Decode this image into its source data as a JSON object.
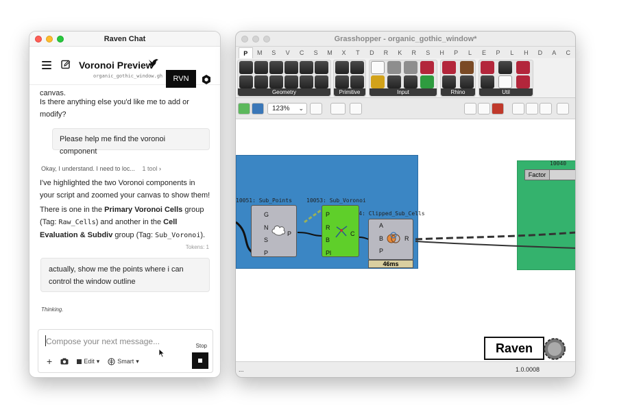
{
  "chat_window": {
    "title": "Raven Chat",
    "header": {
      "preview_title": "Voronoi Preview",
      "file_name": "organic_gothic_window.gh",
      "badge": "RVN"
    },
    "messages": {
      "truncated_text": "canvas.",
      "question": "Is there anything else you'd like me to add or modify?",
      "user_1": "Please help me find the voronoi component",
      "tool_summary": "Okay, I understand. I need to loc...",
      "tool_count": "1 tool",
      "answer_1": "I've highlighted the two Voronoi components in your script and zoomed your canvas to show them!",
      "answer_2_pre": "There is one in the ",
      "answer_2_group1": "Primary Voronoi Cells",
      "answer_2_mid1": " group (Tag: ",
      "answer_2_tag1": "Raw_Cells",
      "answer_2_mid2": ") and another in the ",
      "answer_2_group2": "Cell Evaluation & Subdiv",
      "answer_2_mid3": " group (Tag: ",
      "answer_2_tag2": "Sub_Voronoi",
      "answer_2_end": ").",
      "tokens": "Tokens: 1",
      "user_2": "actually, show me the points where i can control the window outline",
      "thinking": "Thinking."
    },
    "composer": {
      "placeholder": "Compose your next message...",
      "stop_label": "Stop",
      "edit_label": "Edit",
      "mode_label": "Smart"
    }
  },
  "gh_window": {
    "title": "Grasshopper - organic_gothic_window*",
    "tabs": [
      "P",
      "M",
      "S",
      "V",
      "C",
      "S",
      "M",
      "X",
      "T",
      "D",
      "R",
      "K",
      "R",
      "S",
      "H",
      "P",
      "L",
      "E",
      "P",
      "L",
      "H",
      "D",
      "A",
      "C"
    ],
    "ribbon_groups": [
      "Geometry",
      "Primitive",
      "Input",
      "Rhino",
      "Util"
    ],
    "zoom": "123%",
    "canvas": {
      "label_sub_points": "10051: Sub_Points",
      "label_sub_voronoi": "10053: Sub_Voronoi",
      "label_clipped": "10054: Clipped_Sub_Cells",
      "label_green_group": "10040",
      "factor_label": "Factor",
      "timing": "46ms",
      "comp1_ports": [
        "G",
        "N",
        "S",
        "P"
      ],
      "comp1_out": "P",
      "comp2_ports": [
        "P",
        "R",
        "B",
        "Pl"
      ],
      "comp2_out": "C",
      "comp3_ports": [
        "A",
        "B",
        "P"
      ],
      "comp3_out": "R"
    },
    "badge": "Raven",
    "status_left": "...",
    "version": "1.0.0008"
  },
  "colors": {
    "group_blue": "#3b86c4",
    "group_green": "#34b26d",
    "component_green": "#5fcf2a"
  }
}
